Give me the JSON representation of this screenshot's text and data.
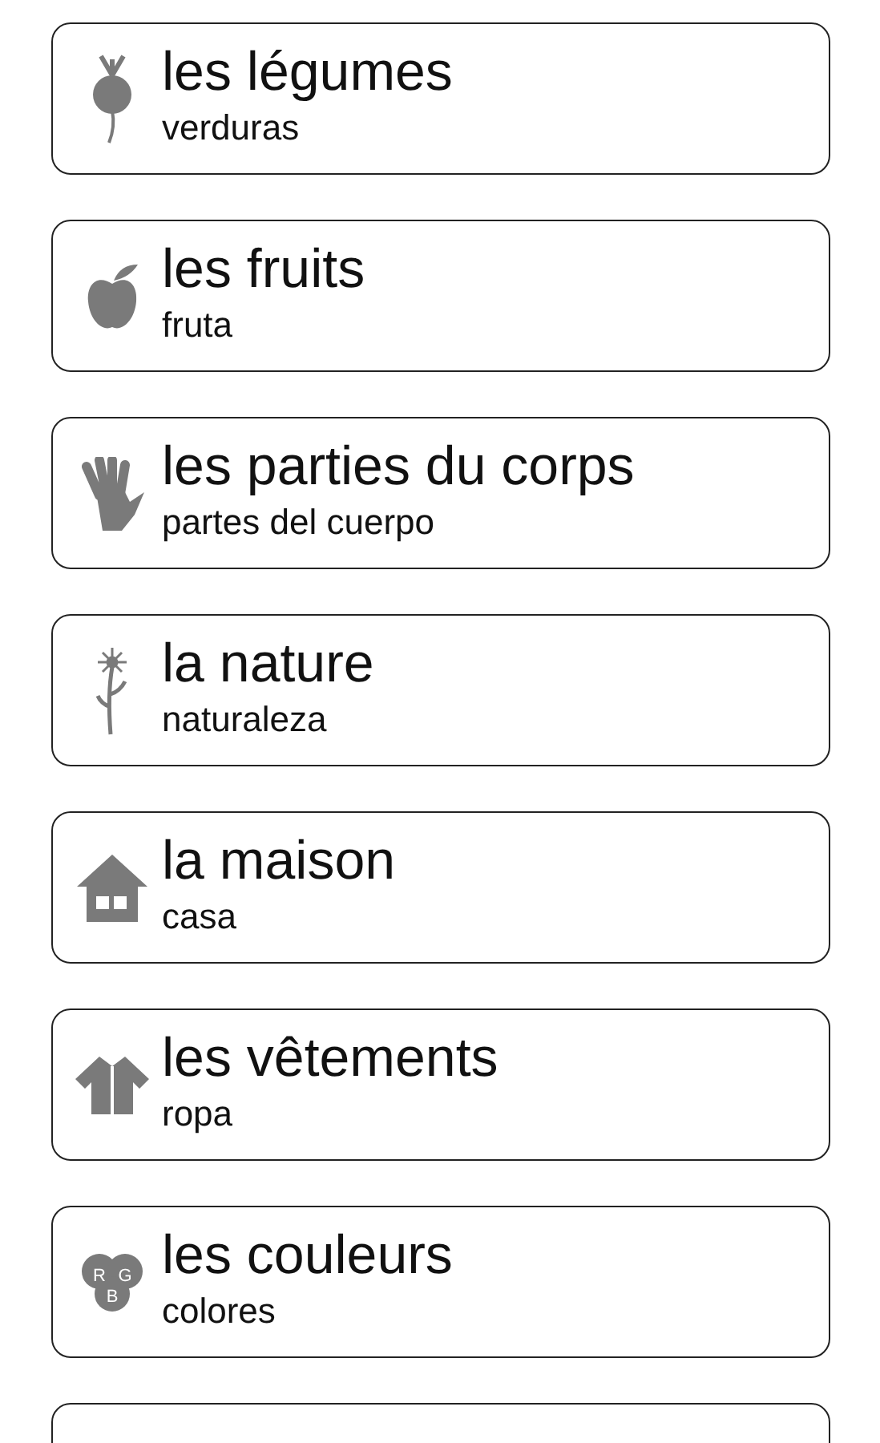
{
  "topics": [
    {
      "title": "les légumes",
      "subtitle": "verduras",
      "icon": {
        "kind": "beet"
      }
    },
    {
      "title": "les fruits",
      "subtitle": "fruta",
      "icon": {
        "kind": "apple"
      }
    },
    {
      "title": "les parties du corps",
      "subtitle": "partes del cuerpo",
      "icon": {
        "kind": "hand"
      }
    },
    {
      "title": "la nature",
      "subtitle": "naturaleza",
      "icon": {
        "kind": "flower"
      }
    },
    {
      "title": "la maison",
      "subtitle": "casa",
      "icon": {
        "kind": "house"
      }
    },
    {
      "title": "les vêtements",
      "subtitle": "ropa",
      "icon": {
        "kind": "jacket"
      }
    },
    {
      "title": "les couleurs",
      "subtitle": "colores",
      "icon": {
        "kind": "rgb",
        "letters": [
          "R",
          "G",
          "B"
        ]
      }
    }
  ],
  "more_below": true
}
